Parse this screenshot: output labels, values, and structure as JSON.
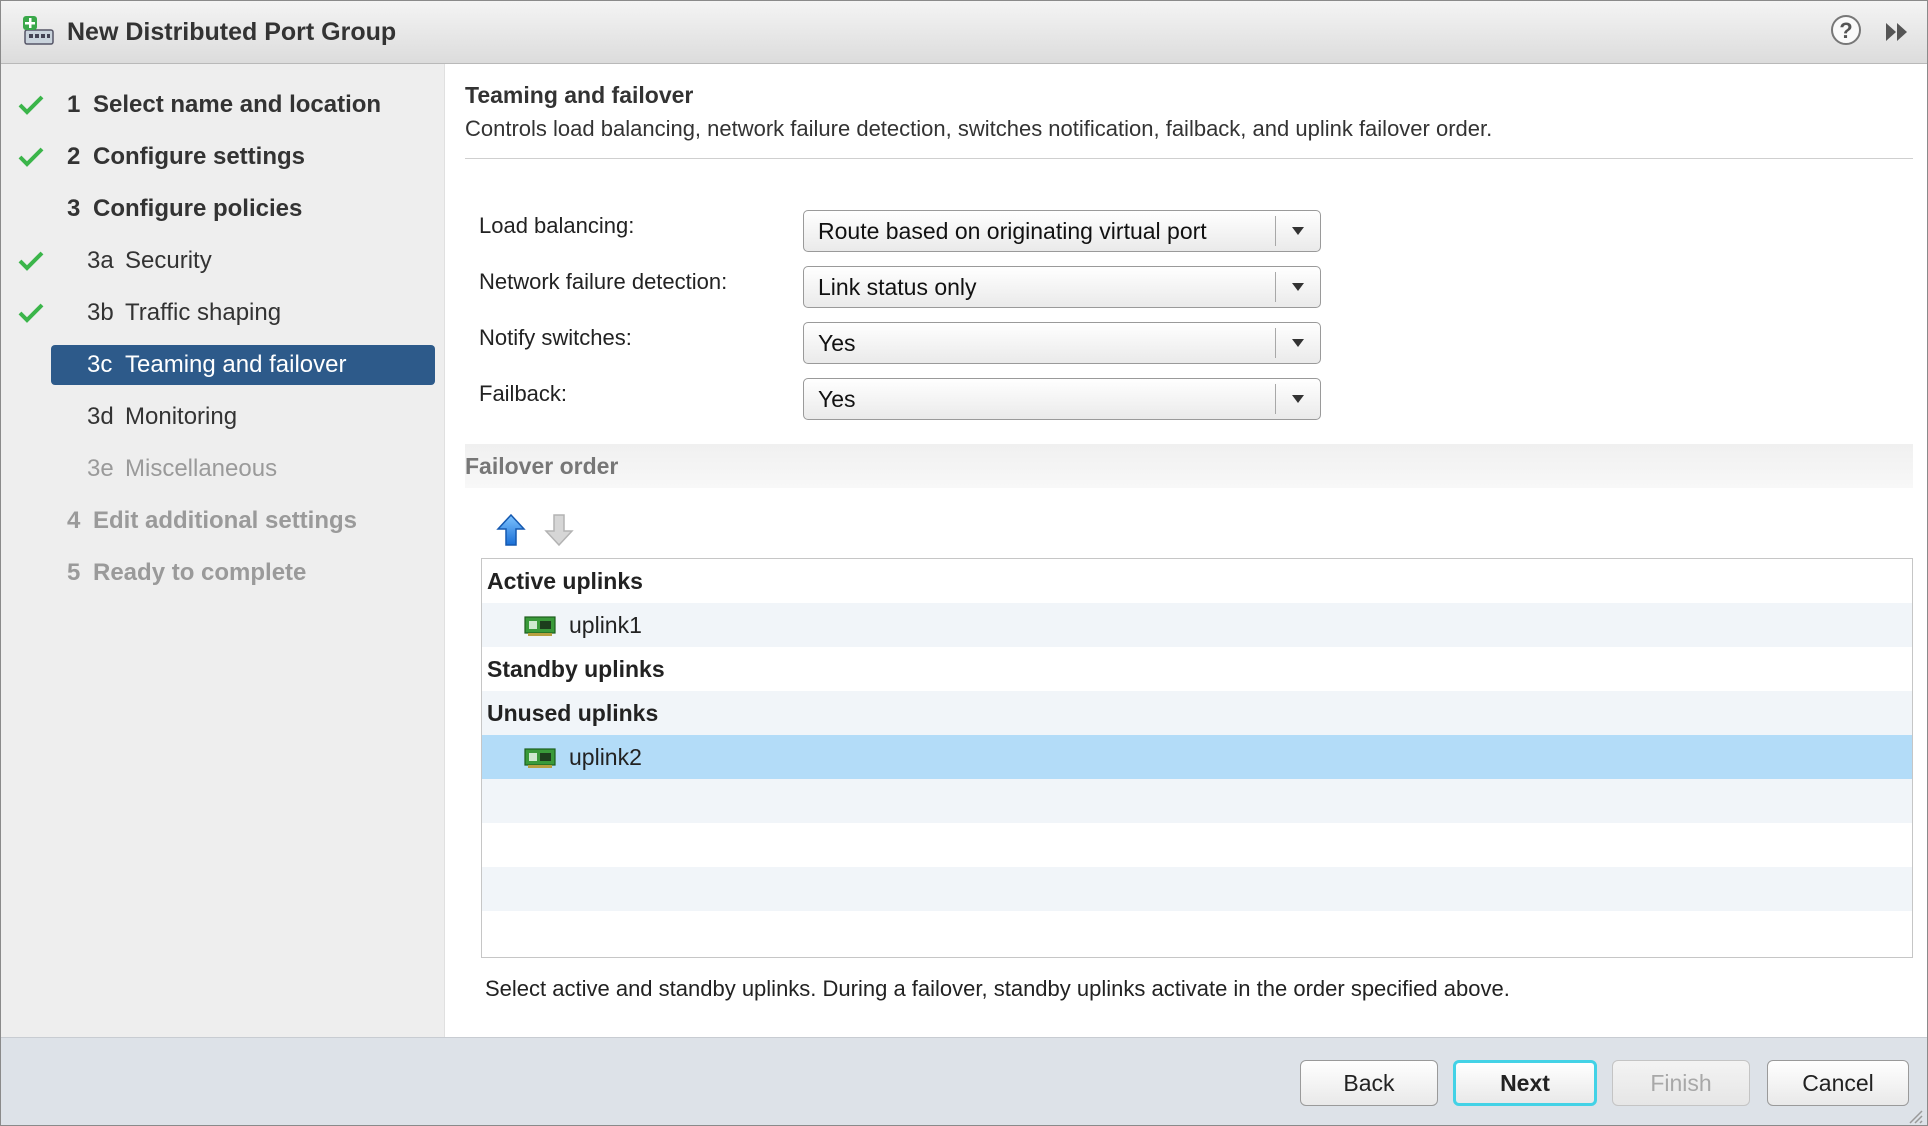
{
  "window": {
    "title": "New Distributed Port Group"
  },
  "sidebar": {
    "steps": [
      {
        "num": "1",
        "label": "Select name and location",
        "checked": true
      },
      {
        "num": "2",
        "label": "Configure settings",
        "checked": true
      },
      {
        "num": "3",
        "label": "Configure policies",
        "checked": false
      },
      {
        "num": "3a",
        "label": "Security",
        "checked": true
      },
      {
        "num": "3b",
        "label": "Traffic shaping",
        "checked": true
      },
      {
        "num": "3c",
        "label": "Teaming and failover",
        "active": true
      },
      {
        "num": "3d",
        "label": "Monitoring"
      },
      {
        "num": "3e",
        "label": "Miscellaneous",
        "disabled": true
      },
      {
        "num": "4",
        "label": "Edit additional settings",
        "disabled": true
      },
      {
        "num": "5",
        "label": "Ready to complete",
        "disabled": true
      }
    ]
  },
  "content": {
    "title": "Teaming and failover",
    "description": "Controls load balancing, network failure detection, switches notification, failback, and uplink failover order.",
    "fields": {
      "load_balancing": {
        "label": "Load balancing:",
        "value": "Route based on originating virtual port"
      },
      "network_failure_detection": {
        "label": "Network failure detection:",
        "value": "Link status only"
      },
      "notify_switches": {
        "label": "Notify switches:",
        "value": "Yes"
      },
      "failback": {
        "label": "Failback:",
        "value": "Yes"
      }
    },
    "failover_order": {
      "title": "Failover order",
      "active_label": "Active uplinks",
      "active_items": [
        "uplink1"
      ],
      "standby_label": "Standby uplinks",
      "unused_label": "Unused uplinks",
      "unused_items": [
        "uplink2"
      ]
    },
    "hint": "Select active and standby uplinks. During a failover, standby uplinks activate in the order specified above."
  },
  "footer": {
    "back": "Back",
    "next": "Next",
    "finish": "Finish",
    "cancel": "Cancel"
  },
  "colors": {
    "active_step": "#2d5a8a",
    "check": "#3bb54a",
    "selected_row": "#b3dcf8",
    "focus_ring": "#43d2e6"
  },
  "icons": {
    "title": "port-group-icon",
    "help": "help-icon",
    "expand": "double-chevron-right-icon",
    "check": "checkmark-icon",
    "move_up": "arrow-up-icon",
    "move_down": "arrow-down-icon",
    "uplink": "network-card-icon"
  }
}
